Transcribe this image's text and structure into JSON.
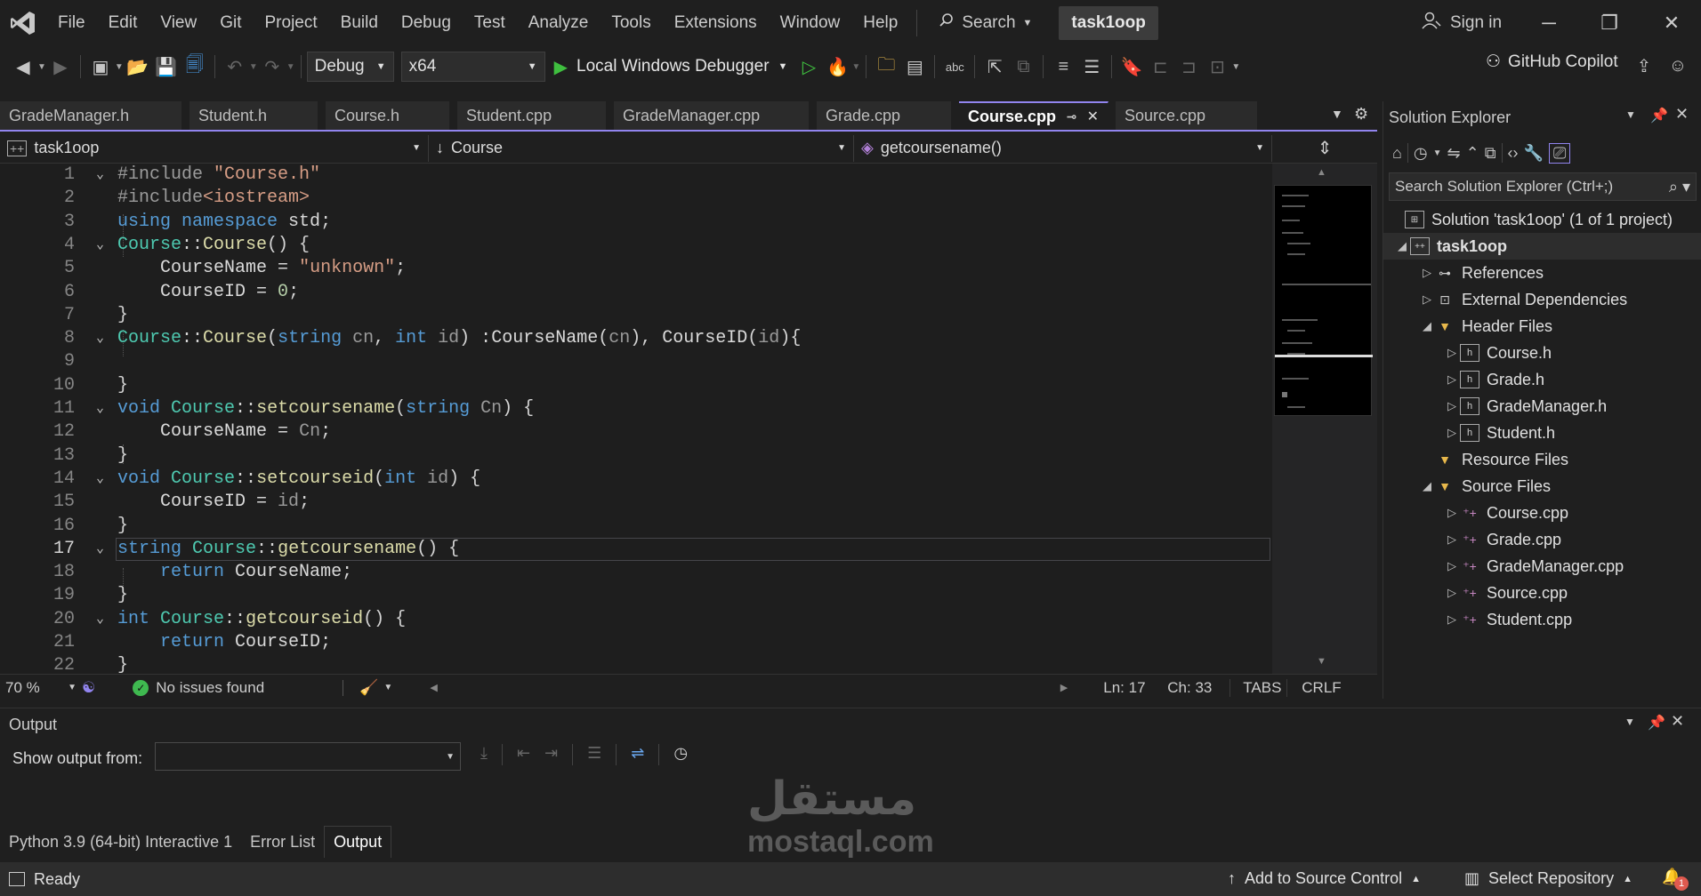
{
  "app": {
    "title": "task1oop",
    "logo": "vs-logo"
  },
  "menu": [
    "File",
    "Edit",
    "View",
    "Git",
    "Project",
    "Build",
    "Debug",
    "Test",
    "Analyze",
    "Tools",
    "Extensions",
    "Window",
    "Help"
  ],
  "search": {
    "label": "Search"
  },
  "account": {
    "sign_in": "Sign in",
    "copilot": "GitHub Copilot"
  },
  "toolbar": {
    "config": "Debug",
    "platform": "x64",
    "run_label": "Local Windows Debugger"
  },
  "tabs": [
    "GradeManager.h",
    "Student.h",
    "Course.h",
    "Student.cpp",
    "GradeManager.cpp",
    "Grade.cpp",
    "Course.cpp",
    "Source.cpp"
  ],
  "active_tab": "Course.cpp",
  "nav": {
    "project": "task1oop",
    "scope": "Course",
    "member": "getcoursename()"
  },
  "code": {
    "lines": [
      "1",
      "2",
      "3",
      "4",
      "5",
      "6",
      "7",
      "8",
      "9",
      "10",
      "11",
      "12",
      "13",
      "14",
      "15",
      "16",
      "17",
      "18",
      "19",
      "20",
      "21",
      "22"
    ],
    "current_line": "17"
  },
  "editor_status": {
    "zoom": "70 %",
    "issues": "No issues found",
    "ln": "Ln: 17",
    "ch": "Ch: 33",
    "tabs": "TABS",
    "eol": "CRLF"
  },
  "solution_explorer": {
    "title": "Solution Explorer",
    "search_placeholder": "Search Solution Explorer (Ctrl+;)",
    "solution": "Solution 'task1oop' (1 of 1 project)",
    "project": "task1oop",
    "references": "References",
    "external": "External Dependencies",
    "header_files": "Header Files",
    "headers": [
      "Course.h",
      "Grade.h",
      "GradeManager.h",
      "Student.h"
    ],
    "resource_files": "Resource Files",
    "source_files": "Source Files",
    "sources": [
      "Course.cpp",
      "Grade.cpp",
      "GradeManager.cpp",
      "Source.cpp",
      "Student.cpp"
    ]
  },
  "output": {
    "title": "Output",
    "show_from": "Show output from:",
    "watermark_ar": "مستقل",
    "watermark_en": "mostaql.com"
  },
  "bottom_tabs": [
    "Python 3.9 (64-bit) Interactive 1",
    "Error List",
    "Output"
  ],
  "statusbar": {
    "ready": "Ready",
    "add_source": "Add to Source Control",
    "select_repo": "Select Repository",
    "notifications": "1"
  },
  "colors": {
    "accent": "#9184ee",
    "background": "#1f1f1f",
    "keyword": "#569cd6",
    "type": "#4ec9b0",
    "function": "#dcdcaa",
    "string": "#d69d85"
  }
}
